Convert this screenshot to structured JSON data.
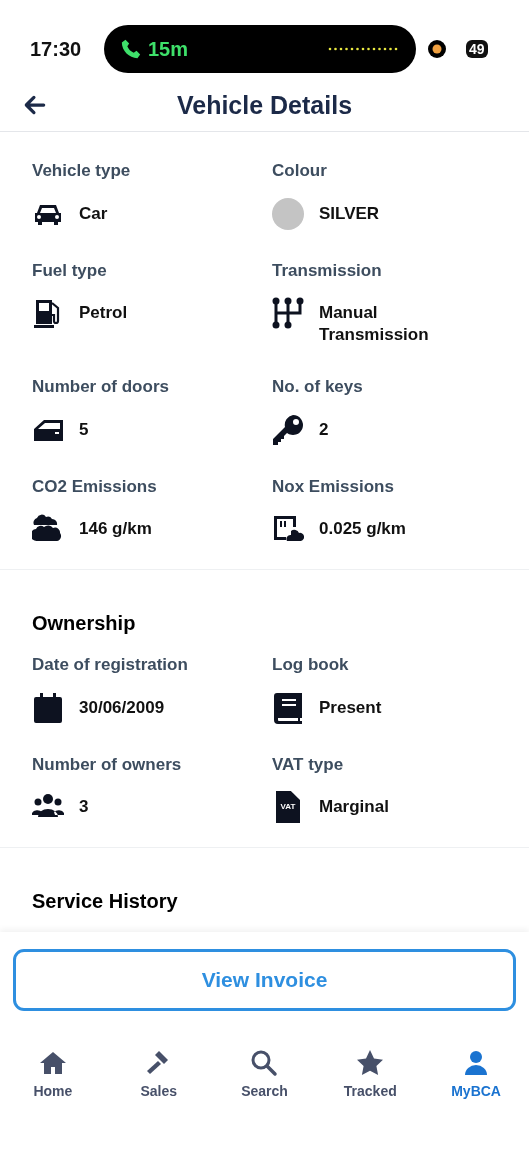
{
  "status_bar": {
    "time": "17:30",
    "call_duration": "15m",
    "battery": "49"
  },
  "header": {
    "title": "Vehicle Details"
  },
  "sections": [
    {
      "items": [
        {
          "label": "Vehicle type",
          "value": "Car",
          "kind": "icon"
        },
        {
          "label": "Colour",
          "value": "SILVER",
          "kind": "swatch",
          "color": "#c4c4c4"
        },
        {
          "label": "Fuel type",
          "value": "Petrol",
          "kind": "icon"
        },
        {
          "label": "Transmission",
          "value": "Manual Transmission",
          "kind": "icon"
        },
        {
          "label": "Number of doors",
          "value": "5",
          "kind": "icon"
        },
        {
          "label": "No. of keys",
          "value": "2",
          "kind": "icon"
        },
        {
          "label": "CO2 Emissions",
          "value": "146 g/km",
          "kind": "icon"
        },
        {
          "label": "Nox Emissions",
          "value": "0.025 g/km",
          "kind": "icon"
        }
      ]
    },
    {
      "title": "Ownership",
      "items": [
        {
          "label": "Date of registration",
          "value": "30/06/2009",
          "kind": "icon"
        },
        {
          "label": "Log book",
          "value": "Present",
          "kind": "icon"
        },
        {
          "label": "Number of owners",
          "value": "3",
          "kind": "icon"
        },
        {
          "label": "VAT type",
          "value": "Marginal",
          "kind": "document",
          "icon_text": "VAT"
        }
      ]
    },
    {
      "title": "Service History"
    }
  ],
  "action_button": "View Invoice",
  "tabs": [
    {
      "label": "Home",
      "selected": false
    },
    {
      "label": "Sales",
      "selected": false
    },
    {
      "label": "Search",
      "selected": false
    },
    {
      "label": "Tracked",
      "selected": false
    },
    {
      "label": "MyBCA",
      "selected": true
    }
  ]
}
